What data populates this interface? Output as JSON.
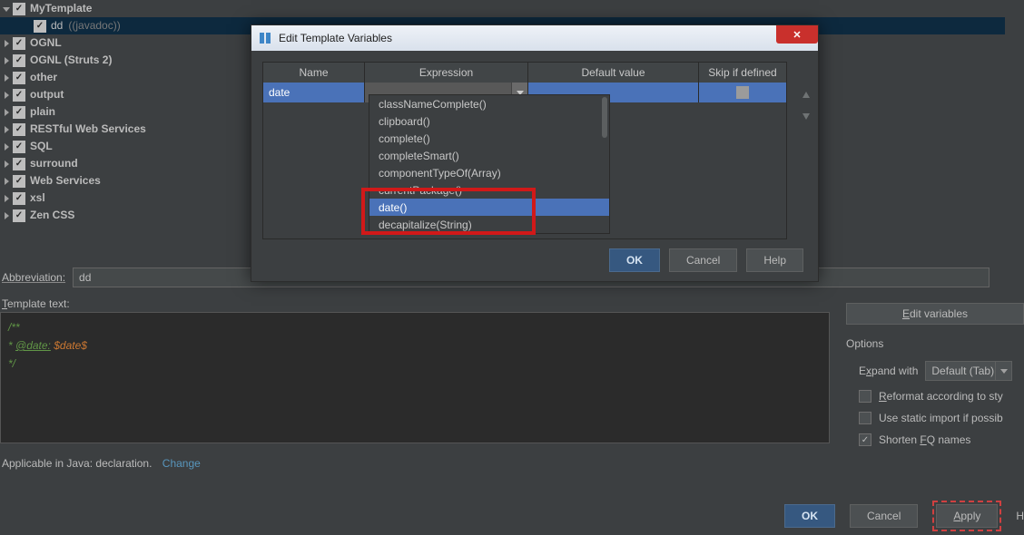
{
  "tree": {
    "root": {
      "label": "MyTemplate"
    },
    "child": {
      "label": "dd",
      "suffix": "((javadoc))"
    },
    "siblings": [
      "OGNL",
      "OGNL (Struts 2)",
      "other",
      "output",
      "plain",
      "RESTful Web Services",
      "SQL",
      "surround",
      "Web Services",
      "xsl",
      "Zen CSS"
    ]
  },
  "abbrev": {
    "label": "Abbreviation:",
    "value": "dd"
  },
  "template_text_label": "Template text:",
  "editor": {
    "l1a": "/**",
    "l2a": " * ",
    "l2b": "@date:",
    "l2c": " $date$",
    "l3a": " */"
  },
  "sidebar": {
    "edit_variables_label": "Edit variables",
    "options_title": "Options",
    "expand_label": "Expand with",
    "expand_value": "Default (Tab)",
    "cb_reformat": "Reformat according to sty",
    "cb_static": "Use static import if possib",
    "cb_fq": "Shorten FQ names"
  },
  "applicable": {
    "text": "Applicable in Java: declaration.",
    "link": "Change"
  },
  "buttons": {
    "ok": "OK",
    "cancel": "Cancel",
    "apply": "Apply",
    "help": "Help"
  },
  "dialog": {
    "title": "Edit Template Variables",
    "cols": {
      "name": "Name",
      "expr": "Expression",
      "def": "Default value",
      "skip": "Skip if defined"
    },
    "row": {
      "name": "date"
    },
    "dropdown": [
      "classNameComplete()",
      "clipboard()",
      "complete()",
      "completeSmart()",
      "componentTypeOf(Array)",
      "currentPackage()",
      "date()",
      "decapitalize(String)"
    ],
    "btns": {
      "ok": "OK",
      "cancel": "Cancel",
      "help": "Help"
    }
  }
}
